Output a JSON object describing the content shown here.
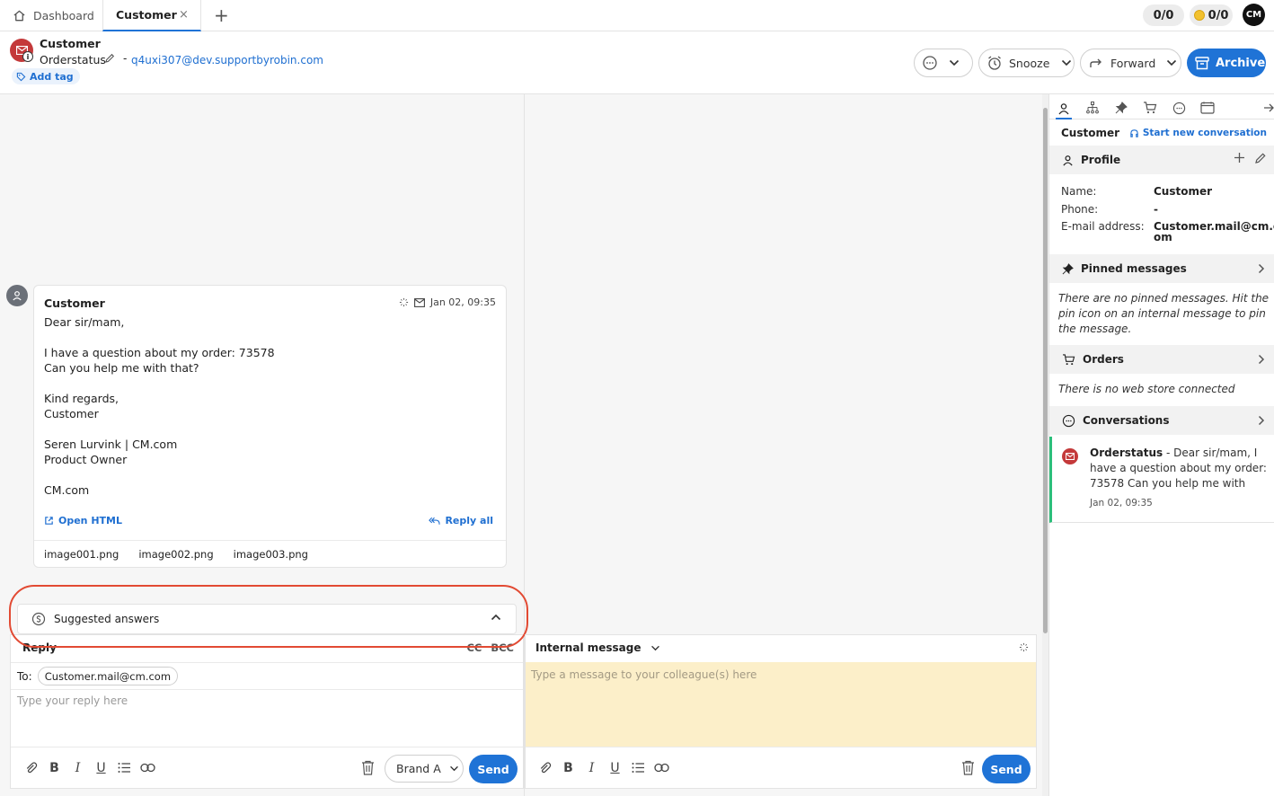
{
  "tabs": {
    "dashboard_label": "Dashboard",
    "customer_label": "Customer",
    "close_symbol": "×",
    "add_symbol": "+"
  },
  "counters": {
    "first": "0/0",
    "second": "0/0"
  },
  "user_avatar_initials": "CM",
  "header": {
    "name": "Customer",
    "subject": "Orderstatus",
    "dash": "-",
    "email": "q4uxi307@dev.supportbyrobin.com",
    "add_tag": "Add tag"
  },
  "actions": {
    "snooze": "Snooze",
    "forward": "Forward",
    "archive": "Archive"
  },
  "message": {
    "from": "Customer",
    "date": "Jan 02, 09:35",
    "lines": [
      "Dear sir/mam,",
      "",
      "I have a question about my order: 73578",
      "Can you help me with that?",
      "",
      "Kind regards,",
      "Customer",
      "",
      "Seren Lurvink | CM.com",
      "Product Owner",
      "",
      "CM.com"
    ],
    "open_html": "Open HTML",
    "reply_all": "Reply all",
    "attachments": [
      "image001.png",
      "image002.png",
      "image003.png"
    ]
  },
  "suggested_answers": "Suggested answers",
  "reply": {
    "label": "Reply",
    "cc": "CC",
    "bcc": "BCC",
    "to_label": "To:",
    "to_value": "Customer.mail@cm.com",
    "placeholder": "Type your reply here",
    "brand": "Brand A",
    "send": "Send"
  },
  "internal": {
    "label": "Internal message",
    "placeholder": "Type a message to your colleague(s) here",
    "send": "Send"
  },
  "right_panel": {
    "title": "Customer",
    "start_new": "Start new conversation",
    "profile": {
      "heading": "Profile",
      "name_label": "Name:",
      "name_value": "Customer",
      "phone_label": "Phone:",
      "phone_value": "-",
      "email_label": "E-mail address:",
      "email_value_1": "Customer.mail@cm.c",
      "email_value_2": "om"
    },
    "pinned": {
      "heading": "Pinned messages",
      "note": "There are no pinned messages. Hit the pin icon on an internal message to pin the message."
    },
    "orders": {
      "heading": "Orders",
      "note": "There is no web store connected"
    },
    "conversations": {
      "heading": "Conversations",
      "item_subject": "Orderstatus",
      "item_snippet": " - Dear sir/mam, I have a question about my order: 73578 Can you help me with that? Kind r...",
      "item_date": "Jan 02, 09:35"
    }
  },
  "colors": {
    "accent": "#1f73d6",
    "mail_avatar": "#c4393a",
    "highlight_ring": "#e24a33",
    "internal_bg": "#fcefc9",
    "conversation_marker": "#2cbf7b"
  }
}
